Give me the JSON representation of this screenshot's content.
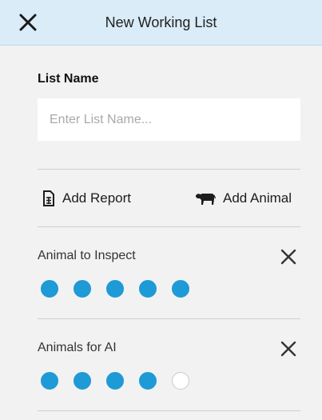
{
  "header": {
    "title": "New Working List",
    "close_icon": "close-icon"
  },
  "form": {
    "list_name_label": "List Name",
    "list_name_placeholder": "Enter List Name...",
    "list_name_value": ""
  },
  "actions": {
    "add_report_label": "Add Report",
    "add_report_icon": "report-icon",
    "add_animal_label": "Add Animal",
    "add_animal_icon": "cow-icon"
  },
  "lists": [
    {
      "label": "Animal to Inspect",
      "filled": 5,
      "total": 5,
      "remove_icon": "remove-icon"
    },
    {
      "label": "Animals for AI",
      "filled": 4,
      "total": 5,
      "remove_icon": "remove-icon"
    }
  ],
  "colors": {
    "header_bg": "#d9ecf8",
    "accent": "#1e9ad6",
    "background": "#f2f2f2"
  }
}
